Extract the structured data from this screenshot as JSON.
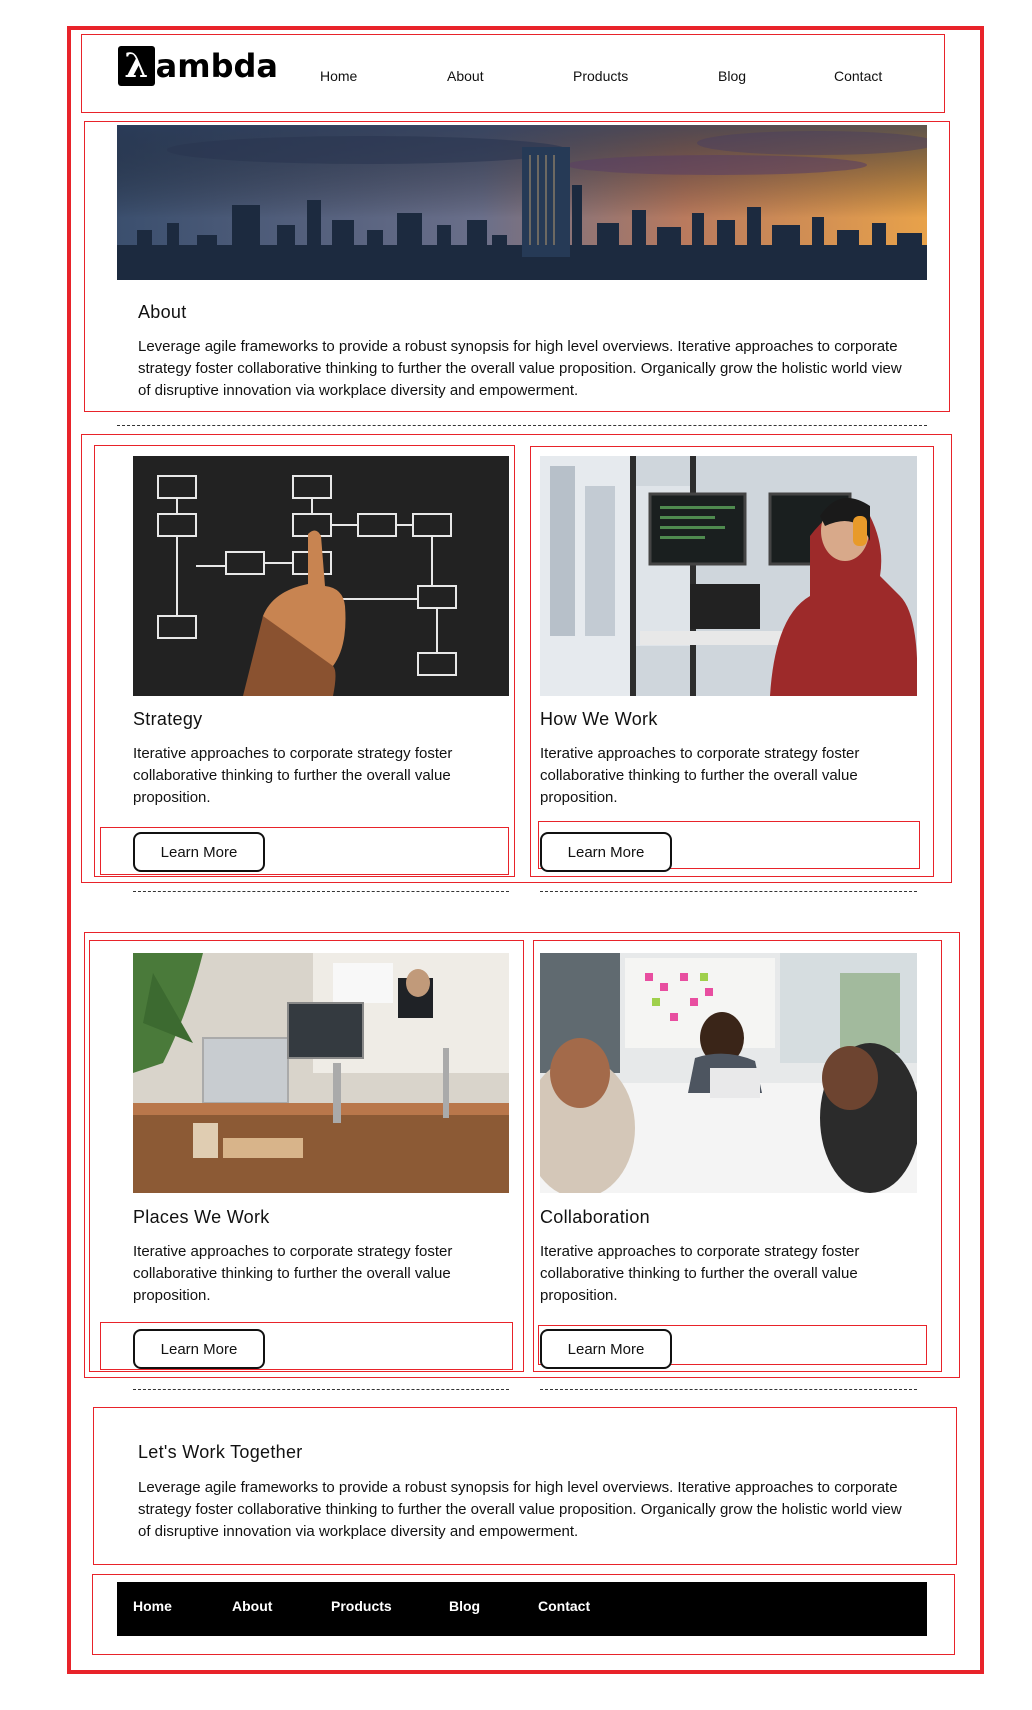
{
  "brand": {
    "logo_mark": "λ",
    "logo_text": "ambda"
  },
  "nav": {
    "items": [
      "Home",
      "About",
      "Products",
      "Blog",
      "Contact"
    ]
  },
  "about": {
    "title": "About",
    "text": "Leverage agile frameworks to provide a robust synopsis for high level overviews. Iterative approaches to corporate strategy foster collaborative thinking to further the overall value proposition. Organically grow the holistic world view of disruptive innovation via workplace diversity and empowerment."
  },
  "cards": [
    {
      "title": "Strategy",
      "text": "Iterative approaches to corporate strategy foster collaborative thinking to further the overall value proposition.",
      "button": "Learn More"
    },
    {
      "title": "How We Work",
      "text": "Iterative approaches to corporate strategy foster collaborative thinking to further the overall value proposition.",
      "button": "Learn More"
    },
    {
      "title": "Places We Work",
      "text": "Iterative approaches to corporate strategy foster collaborative thinking to further the overall value proposition.",
      "button": "Learn More"
    },
    {
      "title": "Collaboration",
      "text": "Iterative approaches to corporate strategy foster collaborative thinking to further the overall value proposition.",
      "button": "Learn More"
    }
  ],
  "together": {
    "title": "Let's Work Together",
    "text": "Leverage agile frameworks to provide a robust synopsis for high level overviews. Iterative approaches to corporate strategy foster collaborative thinking to further the overall value proposition. Organically grow the holistic world view of disruptive innovation via workplace diversity and empowerment."
  },
  "footer": {
    "items": [
      "Home",
      "About",
      "Products",
      "Blog",
      "Contact"
    ]
  },
  "colors": {
    "outline": "#e8232a",
    "footer_bg": "#000000",
    "text": "#111111"
  }
}
